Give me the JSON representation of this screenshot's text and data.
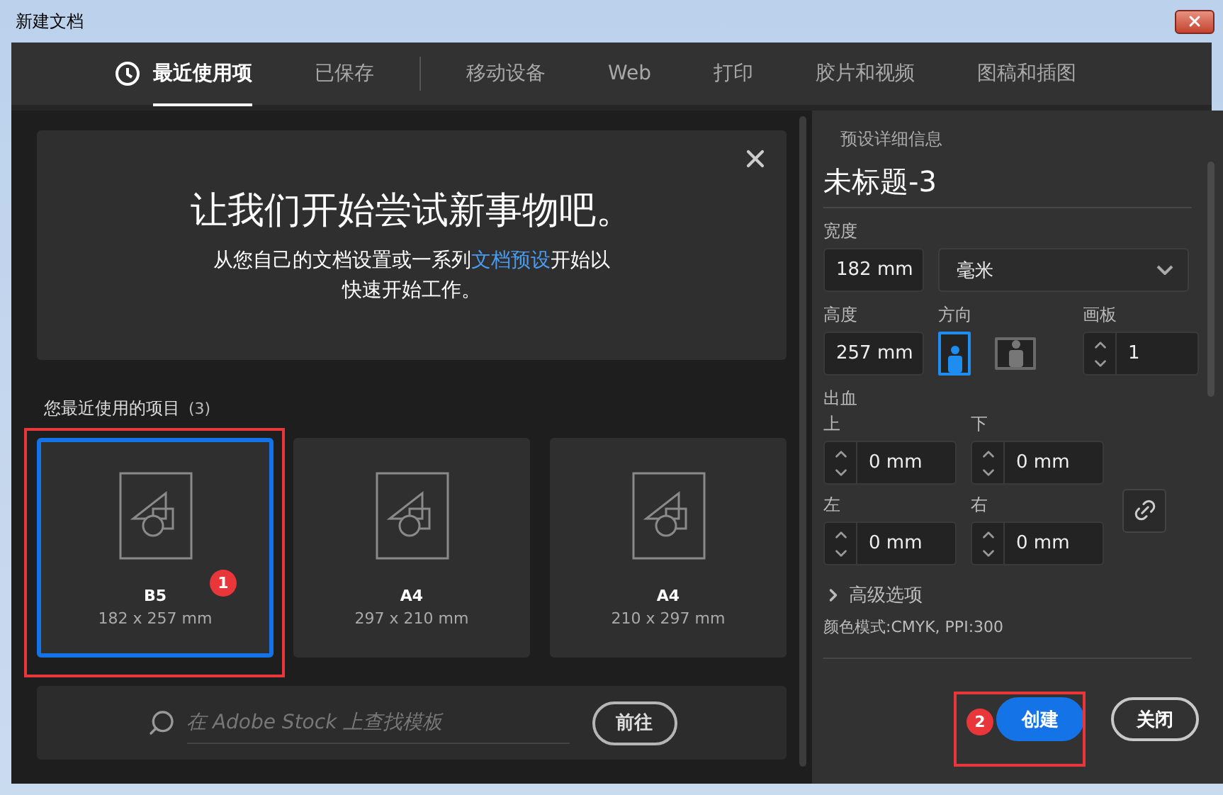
{
  "window": {
    "title": "新建文档"
  },
  "tabs": [
    {
      "label": "最近使用项",
      "selected": true
    },
    {
      "label": "已保存",
      "selected": false
    },
    {
      "label": "移动设备",
      "selected": false
    },
    {
      "label": "Web",
      "selected": false
    },
    {
      "label": "打印",
      "selected": false
    },
    {
      "label": "胶片和视频",
      "selected": false
    },
    {
      "label": "图稿和插图",
      "selected": false
    }
  ],
  "welcome": {
    "title": "让我们开始尝试新事物吧。",
    "text_before": "从您自己的文档设置或一系列",
    "link": "文档预设",
    "text_after": "开始以快速开始工作。"
  },
  "recent": {
    "label": "您最近使用的项目",
    "count": "(3)",
    "items": [
      {
        "name": "B5",
        "size": "182 x 257 mm",
        "selected": true
      },
      {
        "name": "A4",
        "size": "297 x 210 mm",
        "selected": false
      },
      {
        "name": "A4",
        "size": "210 x 297 mm",
        "selected": false
      }
    ]
  },
  "search": {
    "placeholder": "在 Adobe Stock 上查找模板",
    "button": "前往"
  },
  "details": {
    "heading": "预设详细信息",
    "doc_name": "未标题-3",
    "width_label": "宽度",
    "width_value": "182 mm",
    "unit": "毫米",
    "height_label": "高度",
    "height_value": "257 mm",
    "orientation_label": "方向",
    "orientations": [
      {
        "kind": "portrait",
        "selected": true
      },
      {
        "kind": "landscape",
        "selected": false
      }
    ],
    "artboards_label": "画板",
    "artboards_value": "1",
    "bleed_label": "出血",
    "bleed": [
      {
        "label": "上",
        "value": "0 mm"
      },
      {
        "label": "下",
        "value": "0 mm"
      },
      {
        "label": "左",
        "value": "0 mm"
      },
      {
        "label": "右",
        "value": "0 mm"
      }
    ],
    "advanced_label": "高级选项",
    "color_info": "颜色模式:CMYK, PPI:300"
  },
  "buttons": [
    {
      "label": "创建",
      "kind": "primary"
    },
    {
      "label": "关闭",
      "kind": "secondary"
    }
  ],
  "annotations": [
    {
      "number": "1"
    },
    {
      "number": "2"
    }
  ]
}
